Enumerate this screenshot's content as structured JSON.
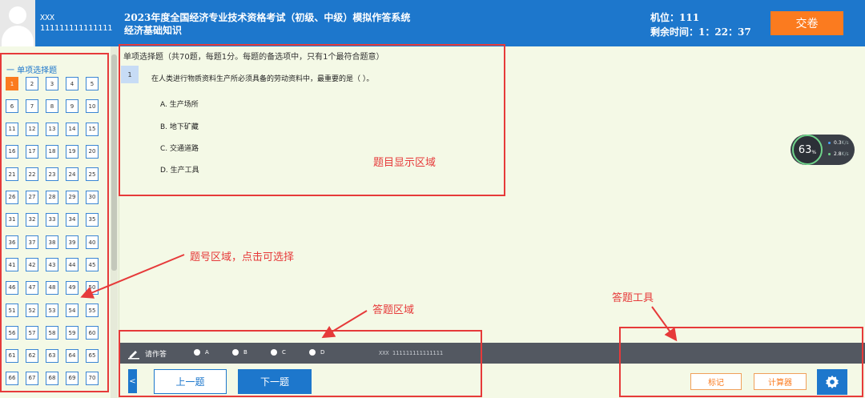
{
  "header": {
    "candidate_name": "XXX",
    "candidate_id": "111111111111111",
    "exam_title": "2023年度全国经济专业技术资格考试（初级、中级）模拟作答系统",
    "exam_subject": "经济基础知识",
    "seat": "机位：111",
    "time_remaining": "剩余时间：1：22：37",
    "submit_label": "交卷"
  },
  "sidebar": {
    "section_title": "一 单项选择题",
    "question_numbers": [
      "1",
      "2",
      "3",
      "4",
      "5",
      "6",
      "7",
      "8",
      "9",
      "10",
      "11",
      "12",
      "13",
      "14",
      "15",
      "16",
      "17",
      "18",
      "19",
      "20",
      "21",
      "22",
      "23",
      "24",
      "25",
      "26",
      "27",
      "28",
      "29",
      "30",
      "31",
      "32",
      "33",
      "34",
      "35",
      "36",
      "37",
      "38",
      "39",
      "40",
      "41",
      "42",
      "43",
      "44",
      "45",
      "46",
      "47",
      "48",
      "49",
      "50",
      "51",
      "52",
      "53",
      "54",
      "55",
      "56",
      "57",
      "58",
      "59",
      "60",
      "61",
      "62",
      "63",
      "64",
      "65",
      "66",
      "67",
      "68",
      "69",
      "70"
    ],
    "current_question": "1"
  },
  "question": {
    "type_header": "单项选择题（共70题，每题1分。每题的备选项中，只有1个最符合题意）",
    "number": "1",
    "text": "在人类进行物质资料生产所必须具备的劳动资料中，最重要的是（ ）。",
    "options": [
      "A. 生产场所",
      "B. 地下矿藏",
      "C. 交通道路",
      "D. 生产工具"
    ]
  },
  "annotations": {
    "question_area": "题目显示区域",
    "number_area": "题号区域，点击可选择",
    "answer_area": "答题区域",
    "tools_area": "答题工具"
  },
  "answer_bar": {
    "prompt": "请作答",
    "choices": [
      "A",
      "B",
      "C",
      "D"
    ],
    "footer": "XXX 111111111111111"
  },
  "nav": {
    "collapse_symbol": "<",
    "prev_label": "上一题",
    "next_label": "下一题",
    "mark_label": "标记",
    "calc_label": "计算器"
  },
  "net_widget": {
    "percent": "63",
    "percent_unit": "%",
    "upload": "0.3",
    "upload_unit": "K/s",
    "download": "2.8",
    "download_unit": "K/s"
  },
  "icons": {
    "pen": "pen-icon",
    "settings": "gear-icon"
  },
  "colors": {
    "header_bg": "#1d77cc",
    "accent_orange": "#fb7b1f",
    "annotation_red": "#e63a3a",
    "answer_bar_bg": "#535861",
    "page_bg": "#f4f9e6"
  }
}
